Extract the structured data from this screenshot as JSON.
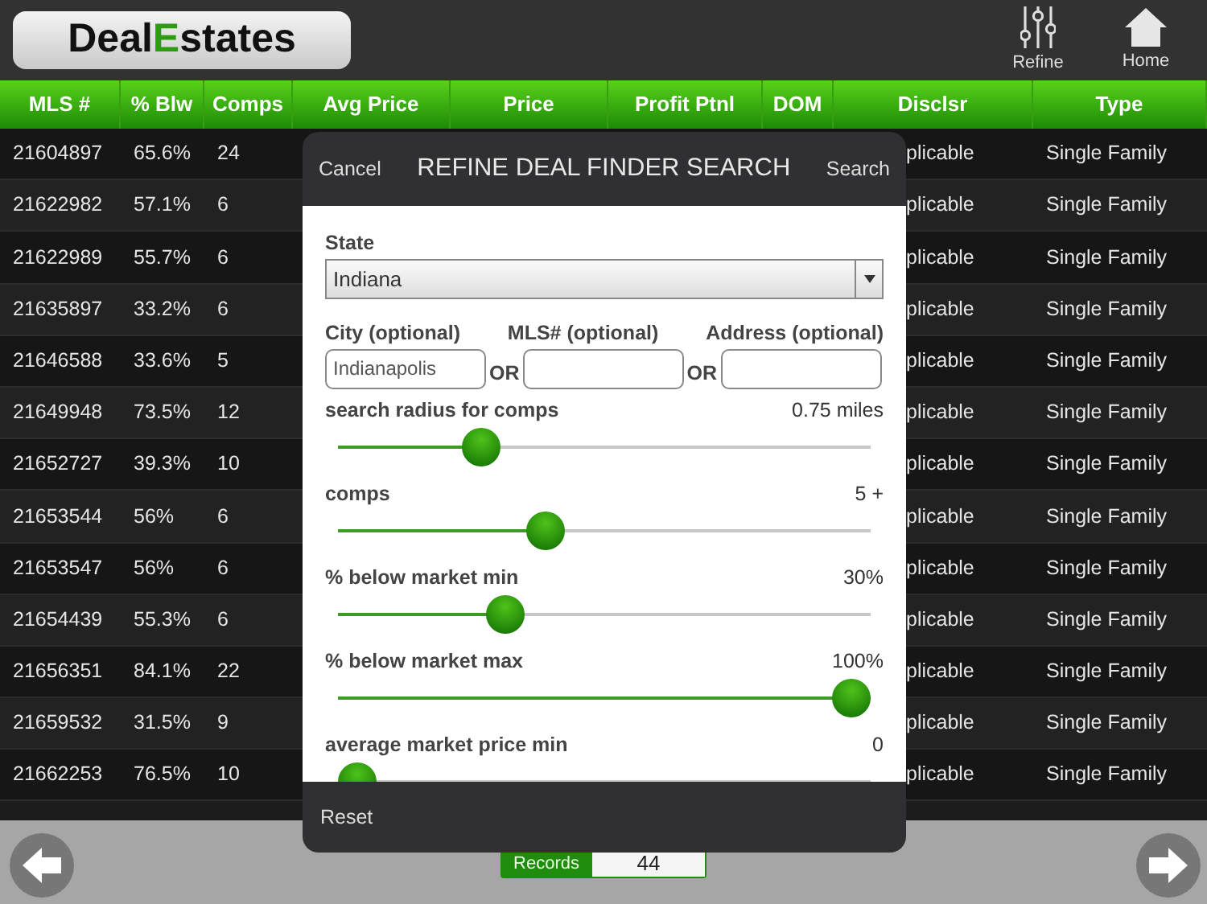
{
  "app": {
    "logo_before": "Deal",
    "logo_letter": "E",
    "logo_after": "states"
  },
  "toolbar": [
    {
      "label": "Refine"
    },
    {
      "label": "Home"
    }
  ],
  "table": {
    "columns": [
      "MLS #",
      "% Blw",
      "Comps",
      "Avg Price",
      "Price",
      "Profit Ptnl",
      "DOM",
      "Disclsr",
      "Type"
    ],
    "rows": [
      {
        "mls": "21604897",
        "blw": "65.6%",
        "comps": "24",
        "disclsr": "plicable",
        "type": "Single Family"
      },
      {
        "mls": "21622982",
        "blw": "57.1%",
        "comps": "6",
        "disclsr": "plicable",
        "type": "Single Family"
      },
      {
        "mls": "21622989",
        "blw": "55.7%",
        "comps": "6",
        "disclsr": "plicable",
        "type": "Single Family"
      },
      {
        "mls": "21635897",
        "blw": "33.2%",
        "comps": "6",
        "disclsr": "plicable",
        "type": "Single Family"
      },
      {
        "mls": "21646588",
        "blw": "33.6%",
        "comps": "5",
        "disclsr": "plicable",
        "type": "Single Family"
      },
      {
        "mls": "21649948",
        "blw": "73.5%",
        "comps": "12",
        "disclsr": "plicable",
        "type": "Single Family"
      },
      {
        "mls": "21652727",
        "blw": "39.3%",
        "comps": "10",
        "disclsr": "plicable",
        "type": "Single Family"
      },
      {
        "mls": "21653544",
        "blw": "56%",
        "comps": "6",
        "disclsr": "plicable",
        "type": "Single Family"
      },
      {
        "mls": "21653547",
        "blw": "56%",
        "comps": "6",
        "disclsr": "plicable",
        "type": "Single Family"
      },
      {
        "mls": "21654439",
        "blw": "55.3%",
        "comps": "6",
        "disclsr": "plicable",
        "type": "Single Family"
      },
      {
        "mls": "21656351",
        "blw": "84.1%",
        "comps": "22",
        "disclsr": "plicable",
        "type": "Single Family"
      },
      {
        "mls": "21659532",
        "blw": "31.5%",
        "comps": "9",
        "disclsr": "plicable",
        "type": "Single Family"
      },
      {
        "mls": "21662253",
        "blw": "76.5%",
        "comps": "10",
        "disclsr": "plicable",
        "type": "Single Family"
      }
    ]
  },
  "footer": {
    "records_label": "Records",
    "records_value": "44"
  },
  "dialog": {
    "cancel": "Cancel",
    "title": "REFINE DEAL FINDER SEARCH",
    "search": "Search",
    "state": {
      "label": "State",
      "value": "Indiana"
    },
    "fields": [
      {
        "label": "City (optional)",
        "value": "Indianapolis"
      },
      {
        "label": "MLS# (optional)",
        "separator": "OR"
      },
      {
        "label": "Address (optional)",
        "separator": "OR"
      }
    ],
    "sliders": [
      {
        "label": "search radius for comps",
        "reading": "0.75 miles",
        "level": 0.25
      },
      {
        "label": "comps",
        "reading": "5 +",
        "level": 0.38
      },
      {
        "label": "% below market min",
        "reading": "30%",
        "level": 0.3
      },
      {
        "label": "% below market max",
        "reading": "100%",
        "level": 1
      },
      {
        "label": "average market price min",
        "reading": "0",
        "level": 0
      }
    ],
    "reset": "Reset"
  }
}
